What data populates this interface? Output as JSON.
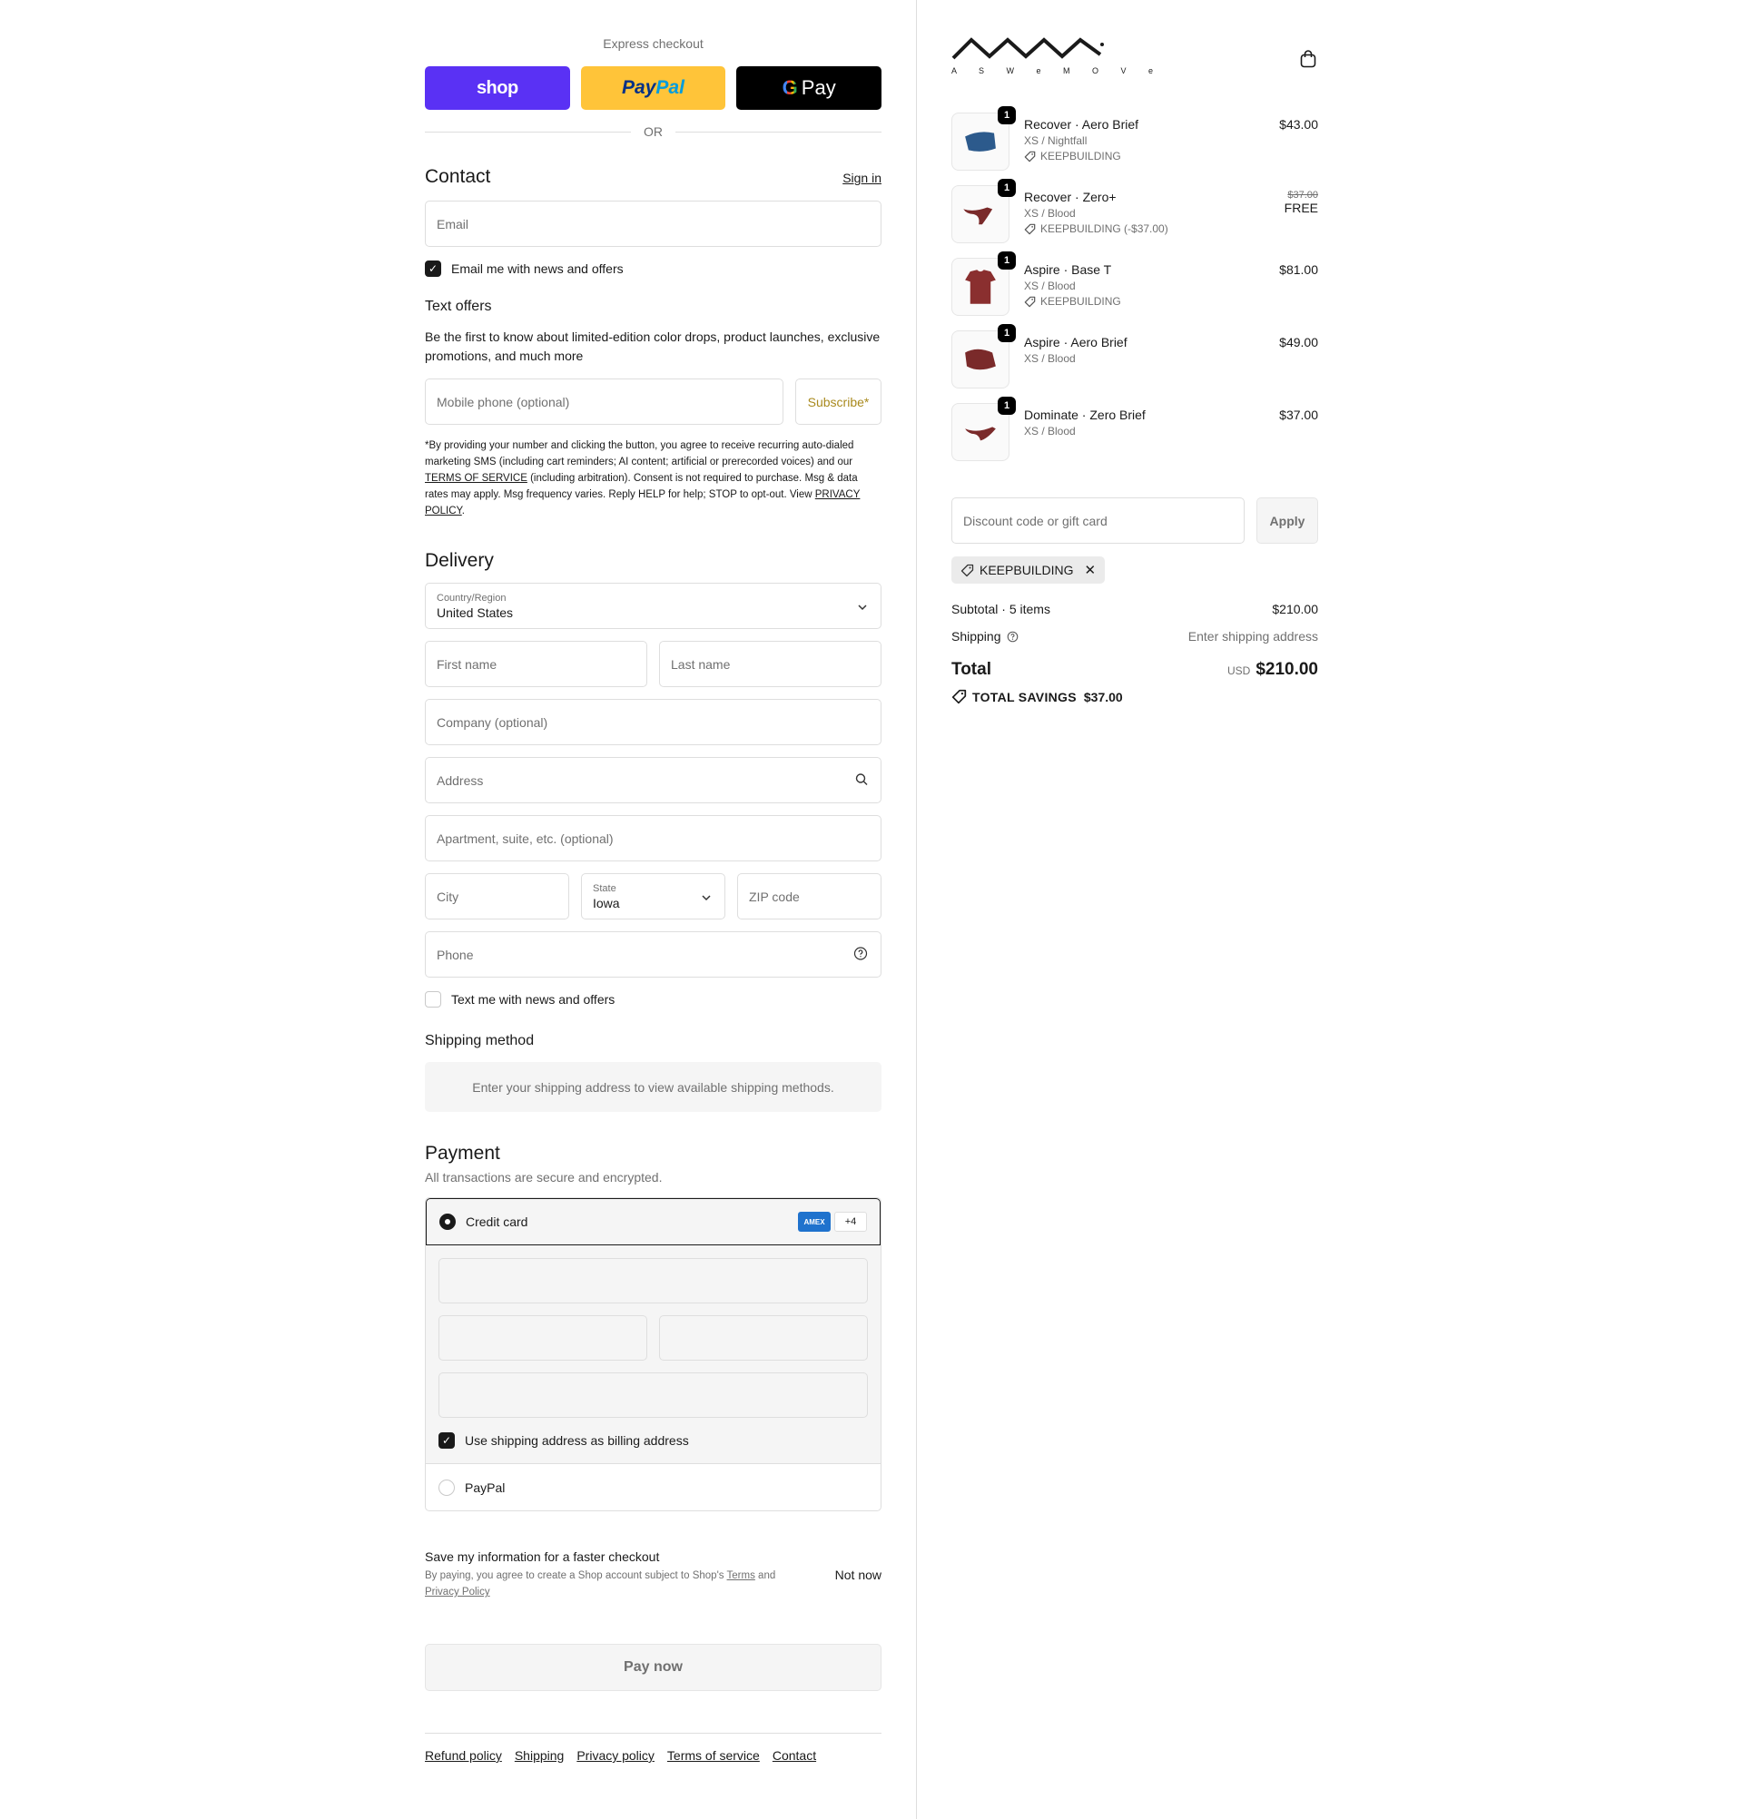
{
  "express": {
    "title": "Express checkout",
    "shop_label": "shop",
    "paypal_pay": "Pay",
    "paypal_pal": "Pal",
    "gpay_label": "Pay",
    "or_label": "OR"
  },
  "contact": {
    "heading": "Contact",
    "sign_in": "Sign in",
    "email_placeholder": "Email",
    "email_news": "Email me with news and offers",
    "text_offers_heading": "Text offers",
    "text_offers_body": "Be the first to know about limited-edition color drops, product launches, exclusive promotions, and much more",
    "mobile_placeholder": "Mobile phone (optional)",
    "subscribe": "Subscribe*",
    "fine_1": "*By providing your number and clicking the button, you agree to receive recurring auto-dialed marketing SMS (including cart reminders; AI content; artificial or prerecorded voices) and our",
    "fine_tos": "TERMS OF SERVICE",
    "fine_2": "(including arbitration). Consent is not required to purchase. Msg & data rates may apply. Msg frequency varies. Reply HELP for help; STOP to opt-out. View",
    "fine_pp": "PRIVACY POLICY",
    "fine_end": "."
  },
  "delivery": {
    "heading": "Delivery",
    "country_label": "Country/Region",
    "country_value": "United States",
    "first_name": "First name",
    "last_name": "Last name",
    "company": "Company (optional)",
    "address": "Address",
    "apartment": "Apartment, suite, etc. (optional)",
    "city": "City",
    "state_label": "State",
    "state_value": "Iowa",
    "zip": "ZIP code",
    "phone": "Phone",
    "text_news": "Text me with news and offers"
  },
  "shipping": {
    "heading": "Shipping method",
    "info": "Enter your shipping address to view available shipping methods."
  },
  "payment": {
    "heading": "Payment",
    "subtitle": "All transactions are secure and encrypted.",
    "credit_card": "Credit card",
    "amex": "AMEX",
    "more_cards": "+4",
    "billing_same": "Use shipping address as billing address",
    "paypal": "PayPal"
  },
  "save_info": {
    "title": "Save my information for a faster checkout",
    "fine_1": "By paying, you agree to create a Shop account subject to Shop's",
    "terms": "Terms",
    "and": "and",
    "privacy": "Privacy Policy",
    "not_now": "Not now"
  },
  "pay_now": "Pay now",
  "footer": [
    "Refund policy",
    "Shipping",
    "Privacy policy",
    "Terms of service",
    "Contact"
  ],
  "brand": {
    "letters": "ASWEMOVE",
    "display": "A S W e M O V e"
  },
  "cart": {
    "items": [
      {
        "qty": "1",
        "name": "Recover · Aero Brief",
        "variant": "XS / Nightfall",
        "discount": "KEEPBUILDING",
        "price": "$43.00",
        "old_price": "",
        "color": "#2c5a8c"
      },
      {
        "qty": "1",
        "name": "Recover · Zero+",
        "variant": "XS / Blood",
        "discount": "KEEPBUILDING (-$37.00)",
        "price": "FREE",
        "old_price": "$37.00",
        "color": "#7a2a2a"
      },
      {
        "qty": "1",
        "name": "Aspire · Base T",
        "variant": "XS / Blood",
        "discount": "KEEPBUILDING",
        "price": "$81.00",
        "old_price": "",
        "color": "#8a2f2f"
      },
      {
        "qty": "1",
        "name": "Aspire · Aero Brief",
        "variant": "XS / Blood",
        "discount": "",
        "price": "$49.00",
        "old_price": "",
        "color": "#7a2a2a"
      },
      {
        "qty": "1",
        "name": "Dominate · Zero Brief",
        "variant": "XS / Blood",
        "discount": "",
        "price": "$37.00",
        "old_price": "",
        "color": "#7a2a2a"
      }
    ]
  },
  "discount": {
    "placeholder": "Discount code or gift card",
    "apply": "Apply",
    "chip": "KEEPBUILDING"
  },
  "summary": {
    "subtotal_label": "Subtotal · 5 items",
    "subtotal_value": "$210.00",
    "shipping_label": "Shipping",
    "shipping_value": "Enter shipping address",
    "total_label": "Total",
    "currency": "USD",
    "total_value": "$210.00",
    "savings_label": "TOTAL SAVINGS",
    "savings_value": "$37.00"
  }
}
